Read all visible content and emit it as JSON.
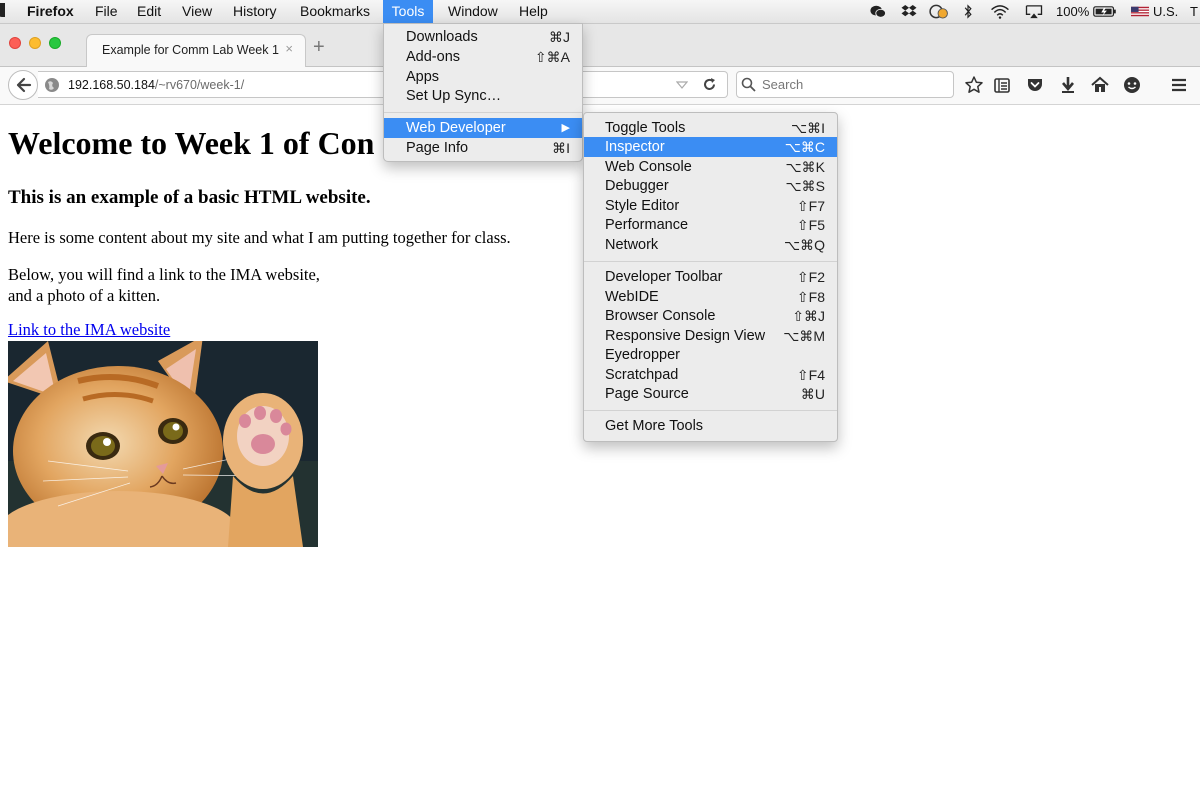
{
  "menubar": {
    "app": "Firefox",
    "items": [
      "File",
      "Edit",
      "View",
      "History",
      "Bookmarks",
      "Tools",
      "Window",
      "Help"
    ],
    "active_item": "Tools",
    "battery": "100%",
    "input_source": "U.S.",
    "trailing": "T"
  },
  "browser": {
    "tab_title": "Example for Comm Lab Week 1",
    "tab_close": "×",
    "new_tab": "+",
    "url_host": "192.168.50.184",
    "url_path": "/~rv670/week-1/",
    "search_placeholder": "Search"
  },
  "page": {
    "heading": "Welcome to Week 1 of Con",
    "subheading": "This is an example of a basic HTML website.",
    "paragraph1": "Here is some content about my site and what I am putting together for class.",
    "paragraph2_line1": "Below, you will find a link to the IMA website,",
    "paragraph2_line2": "and a photo of a kitten.",
    "link_text": "Link to the IMA website"
  },
  "tools_menu": {
    "items": [
      {
        "label": "Downloads",
        "shortcut": "⌘J"
      },
      {
        "label": "Add-ons",
        "shortcut": "⇧⌘A"
      },
      {
        "label": "Apps",
        "shortcut": ""
      },
      {
        "label": "Set Up Sync…",
        "shortcut": ""
      },
      {
        "label": "Web Developer",
        "shortcut": "▶"
      },
      {
        "label": "Page Info",
        "shortcut": "⌘I"
      }
    ]
  },
  "webdev_menu": {
    "items": [
      {
        "label": "Toggle Tools",
        "shortcut": "⌥⌘I"
      },
      {
        "label": "Inspector",
        "shortcut": "⌥⌘C"
      },
      {
        "label": "Web Console",
        "shortcut": "⌥⌘K"
      },
      {
        "label": "Debugger",
        "shortcut": "⌥⌘S"
      },
      {
        "label": "Style Editor",
        "shortcut": "⇧F7"
      },
      {
        "label": "Performance",
        "shortcut": "⇧F5"
      },
      {
        "label": "Network",
        "shortcut": "⌥⌘Q"
      },
      {
        "label": "Developer Toolbar",
        "shortcut": "⇧F2"
      },
      {
        "label": "WebIDE",
        "shortcut": "⇧F8"
      },
      {
        "label": "Browser Console",
        "shortcut": "⇧⌘J"
      },
      {
        "label": "Responsive Design View",
        "shortcut": "⌥⌘M"
      },
      {
        "label": "Eyedropper",
        "shortcut": ""
      },
      {
        "label": "Scratchpad",
        "shortcut": "⇧F4"
      },
      {
        "label": "Page Source",
        "shortcut": "⌘U"
      },
      {
        "label": "Get More Tools",
        "shortcut": ""
      }
    ]
  },
  "colors": {
    "highlight": "#3b8df3",
    "link": "#0000ee"
  }
}
